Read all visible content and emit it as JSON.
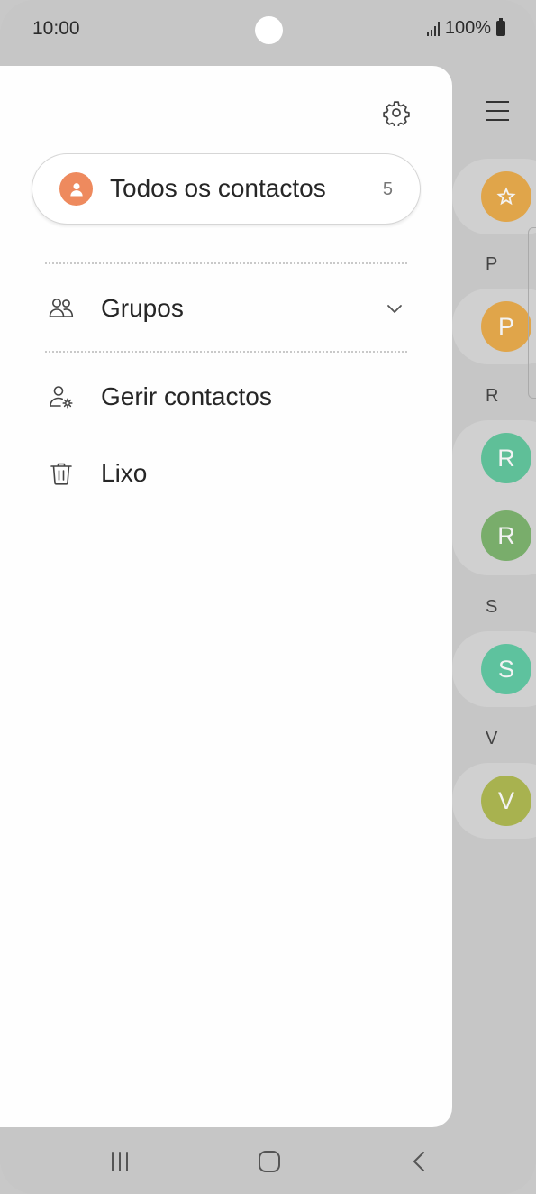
{
  "status_bar": {
    "time": "10:00",
    "battery": "100%"
  },
  "drawer": {
    "settings_icon": "gear-icon",
    "all_contacts": {
      "label": "Todos os contactos",
      "count": "5",
      "icon": "person-icon",
      "color": "#ee8a5e"
    },
    "items": [
      {
        "label": "Grupos",
        "icon": "groups-icon",
        "expandable": true
      },
      {
        "label": "Gerir contactos",
        "icon": "manage-contacts-icon"
      },
      {
        "label": "Lixo",
        "icon": "trash-icon"
      }
    ]
  },
  "background_list": {
    "sections": [
      {
        "letter": "P",
        "contacts": [
          {
            "initial": "P",
            "color": "#e0a54a"
          }
        ]
      },
      {
        "letter": "R",
        "contacts": [
          {
            "initial": "R",
            "color": "#5fbf98"
          },
          {
            "initial": "R",
            "color": "#79ad6b"
          }
        ]
      },
      {
        "letter": "S",
        "contacts": [
          {
            "initial": "S",
            "color": "#5ec29e"
          }
        ]
      },
      {
        "letter": "V",
        "contacts": [
          {
            "initial": "V",
            "color": "#a8b24f"
          }
        ]
      }
    ],
    "favorites_color": "#e0a54a"
  },
  "nav_bar": {
    "recents_icon": "recents-icon",
    "home_icon": "home-icon",
    "back_icon": "back-icon"
  }
}
